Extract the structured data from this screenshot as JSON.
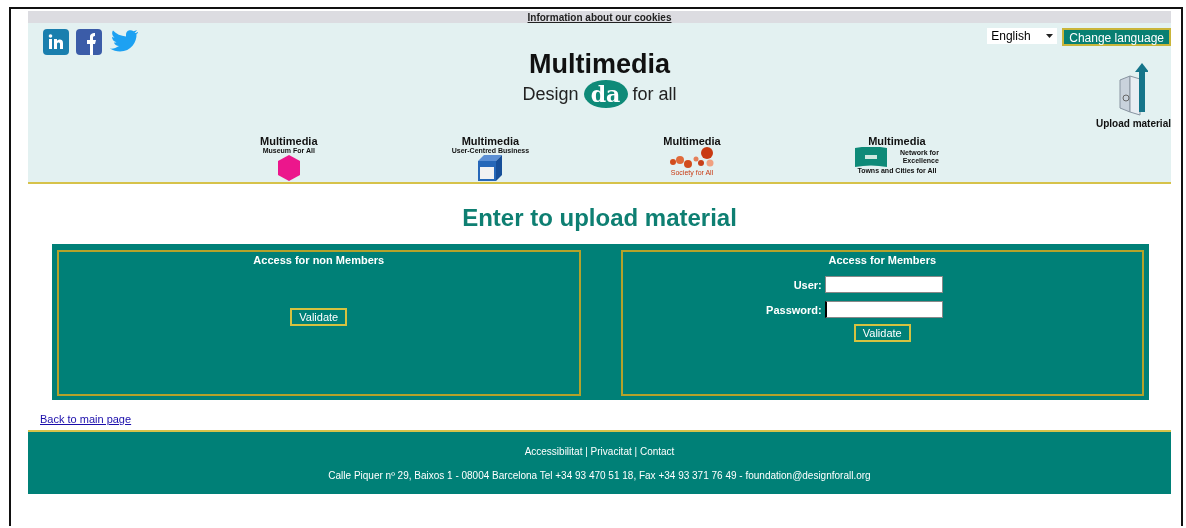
{
  "cookie_link": "Information about our cookies",
  "social": [
    {
      "kind": "linkedin"
    },
    {
      "kind": "facebook"
    },
    {
      "kind": "twitter"
    }
  ],
  "language": {
    "value": "English",
    "button": "Change language"
  },
  "logo": {
    "title": "Multimedia",
    "left": "Design",
    "mark": "da",
    "right": "for all"
  },
  "upload_link": "Upload material",
  "sections": [
    {
      "kind": "museum",
      "title": "Multimedia",
      "subtitle": "Museum For All"
    },
    {
      "kind": "business",
      "title": "Multimedia",
      "subtitle": "User-Centred Business"
    },
    {
      "kind": "society",
      "title": "Multimedia",
      "caption": "Society for All"
    },
    {
      "kind": "network",
      "title": "Multimedia",
      "side": "Network for Excellence",
      "caption": "Towns and Cities for All"
    }
  ],
  "heading": "Enter to upload material",
  "non_members": {
    "title": "Access for non Members",
    "button": "Validate"
  },
  "members": {
    "title": "Access for Members",
    "fields": [
      {
        "label": "User:",
        "focused": false
      },
      {
        "label": "Password:",
        "focused": true
      }
    ],
    "button": "Validate"
  },
  "back_link": "Back to main page",
  "footer": {
    "links": [
      "Accessibilitat",
      "Privacitat",
      "Contact"
    ],
    "separators": [
      "|",
      "|"
    ],
    "address": "Calle Piquer nº 29, Baixos 1 - 08004 Barcelona Tel +34 93 470 51 18, Fax +34 93 371 76 49 - foundation@designforall.org"
  }
}
